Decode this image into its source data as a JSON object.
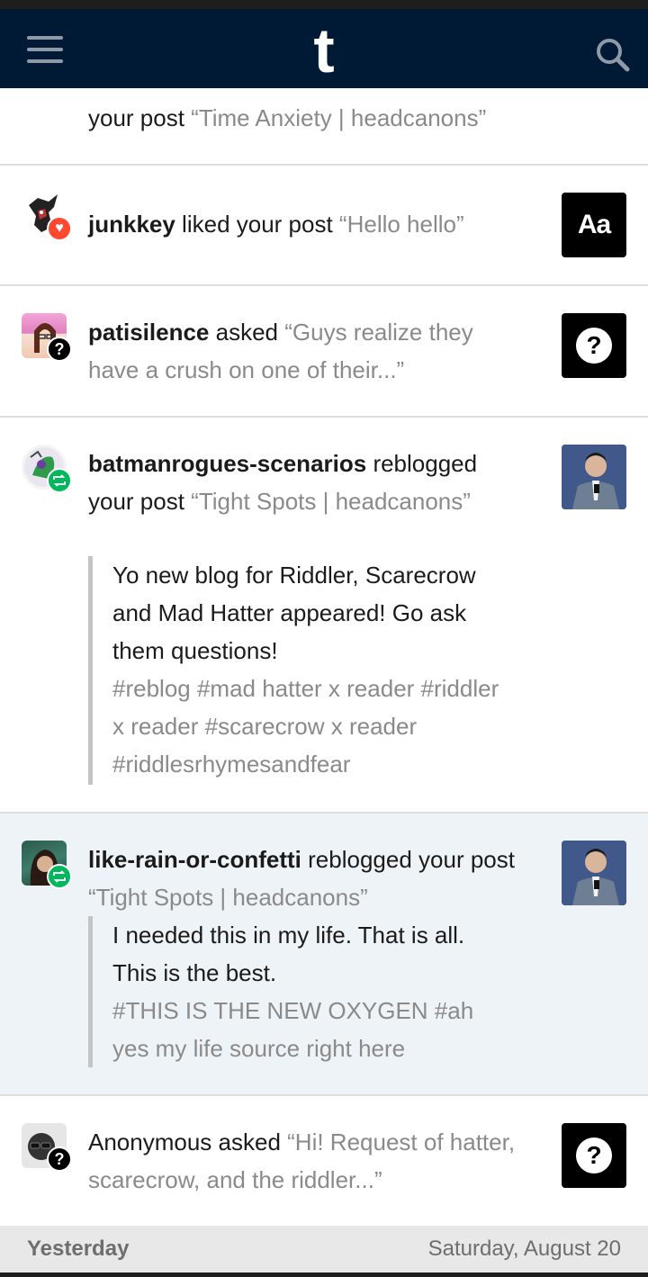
{
  "header": {
    "logo": "t"
  },
  "notifications": [
    {
      "partial": "your post ",
      "quote": "“Time Anxiety  | headcanons”"
    },
    {
      "user": "junkkey",
      "action": " liked your post ",
      "quote": "“Hello hello”",
      "thumb": "Aa",
      "badge": "heart-icon"
    },
    {
      "user": "patisilence",
      "action": " asked ",
      "quote": "“Guys realize they have a crush on one of their...”",
      "thumb": "?",
      "badge": "question-icon"
    },
    {
      "user": "batmanrogues-scenarios",
      "action": " reblogged your post ",
      "quote": "“Tight Spots  |  headcanons”",
      "body": "Yo new blog for Riddler, Scarecrow and Mad Hatter appeared! Go ask them questions!",
      "tags": "#reblog #mad hatter x reader #riddler x reader #scarecrow x reader #riddlesrhymesandfear",
      "badge": "reblog-icon"
    },
    {
      "user": "like-rain-or-confetti",
      "action": " reblogged your post ",
      "quote": "“Tight Spots  | headcanons”",
      "body": "I needed this in my life. That is all. This is the best.",
      "tags": "#THIS IS THE NEW OXYGEN #ah yes my life source right here",
      "badge": "reblog-icon"
    },
    {
      "user": "Anonymous",
      "action": " asked ",
      "quote": "“Hi! Request of hatter, scarecrow, and the riddler...”",
      "thumb": "?",
      "badge": "question-icon"
    }
  ],
  "footer": {
    "left": "Yesterday",
    "right": "Saturday, August 20"
  },
  "colors": {
    "header_bg": "#001935",
    "heart": "#ff4930",
    "reblog": "#00b85c",
    "highlight": "#eef3f8"
  }
}
